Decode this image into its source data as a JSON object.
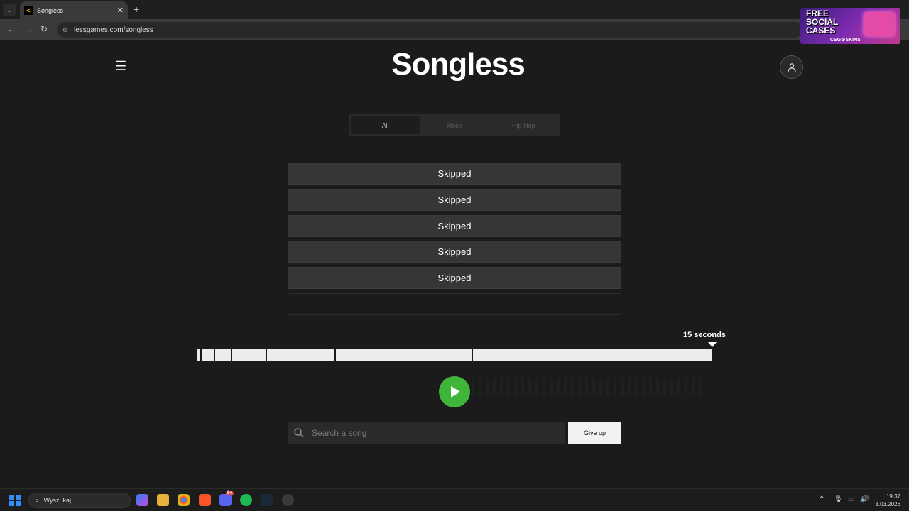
{
  "browser": {
    "tab_title": "Songless",
    "tab_close": "✕",
    "new_tab": "+",
    "url": "lessgames.com/songless"
  },
  "ad": {
    "headline_1": "FREE",
    "headline_2": "SOCIAL",
    "headline_3": "CASES",
    "brand": "CSG⚙SKINS"
  },
  "header": {
    "title": "Songless"
  },
  "genres": [
    {
      "label": "All",
      "active": true
    },
    {
      "label": "Rock",
      "active": false
    },
    {
      "label": "Hip Hop",
      "active": false
    }
  ],
  "guesses": [
    {
      "label": "Skipped"
    },
    {
      "label": "Skipped"
    },
    {
      "label": "Skipped"
    },
    {
      "label": "Skipped"
    },
    {
      "label": "Skipped"
    },
    {
      "label": ""
    }
  ],
  "player": {
    "duration_label": "15 seconds",
    "segment_seconds": [
      0.5,
      1,
      2,
      4,
      8,
      15
    ],
    "total_seconds": 15
  },
  "search": {
    "placeholder": "Search a song",
    "value": ""
  },
  "actions": {
    "give_up": "Give up"
  },
  "taskbar": {
    "search_text": "Wyszukaj",
    "time": "19:37",
    "date": "3.03.2026",
    "discord_badge": "9+"
  },
  "colors": {
    "background": "#1b1b1b",
    "guess_row": "#353737",
    "play_button": "#3fb53a",
    "timeline": "#ececec"
  }
}
